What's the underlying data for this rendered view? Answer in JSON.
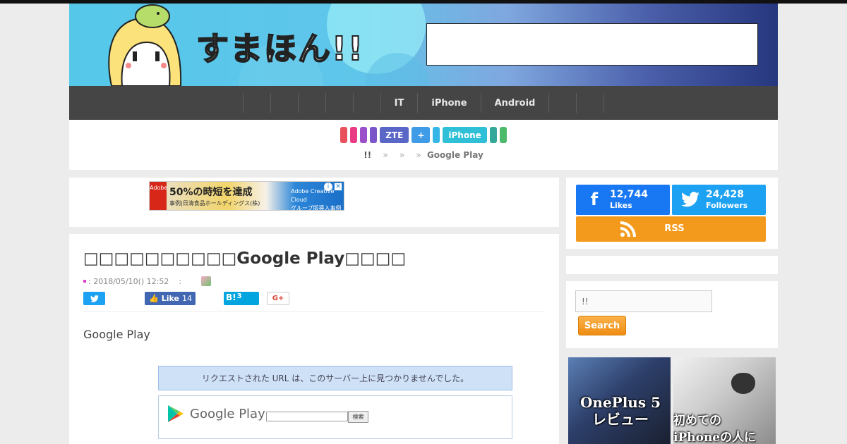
{
  "header": {
    "logo_text": "すまほん!!"
  },
  "nav": {
    "items": [
      "",
      "",
      "",
      "",
      "",
      "IT",
      "iPhone",
      "Android",
      "",
      ""
    ]
  },
  "tags": [
    {
      "label": "",
      "color": "#e8505b"
    },
    {
      "label": "",
      "color": "#e83c86"
    },
    {
      "label": "",
      "color": "#9b4fc9"
    },
    {
      "label": "",
      "color": "#7a56c9"
    },
    {
      "label": "ZTE",
      "color": "#5a67c7"
    },
    {
      "label": "+",
      "color": "#3f9be6"
    },
    {
      "label": "",
      "color": "#35b6e6"
    },
    {
      "label": "iPhone",
      "color": "#2fc0d8"
    },
    {
      "label": "",
      "color": "#33a89a"
    },
    {
      "label": "",
      "color": "#4cba6a"
    }
  ],
  "breadcrumb": {
    "home": "!!",
    "sep": "»",
    "current": "Google Play"
  },
  "ad_banner": {
    "brand": "Adobe",
    "headline": "50%の時短を達成",
    "sub": "事例|日清食品ホールディングス(株)",
    "right_line1": "Adobe Creative Cloud",
    "right_line2": "グループ版導入事例",
    "info": "i",
    "close": "✕"
  },
  "article": {
    "title": "□□□□□□□□□□Google Play□□□□",
    "date": ": 2018/05/10() 12:52",
    "author_sep": ":",
    "share": {
      "fb_label": "Like",
      "fb_count": "14",
      "hb_label": "B!",
      "hb_count": "3",
      "gp_label": "G+"
    },
    "body": "Google Play",
    "notfound_text": "リクエストされた URL は、このサーバー上に見つかりませんでした。",
    "gp_word": "Google Play",
    "gp_search_button": "検索"
  },
  "sidebar": {
    "facebook": {
      "count": "12,744",
      "label": "Likes"
    },
    "twitter": {
      "count": "24,428",
      "label": "Followers"
    },
    "rss": {
      "label": "RSS"
    },
    "search": {
      "value": "!!",
      "button": "Search"
    },
    "thumbs": [
      {
        "caption_line1": "OnePlus 5",
        "caption_line2": "レビュー"
      },
      {
        "caption_line1": "初めての",
        "caption_line2": "iPhoneの人に"
      }
    ]
  }
}
